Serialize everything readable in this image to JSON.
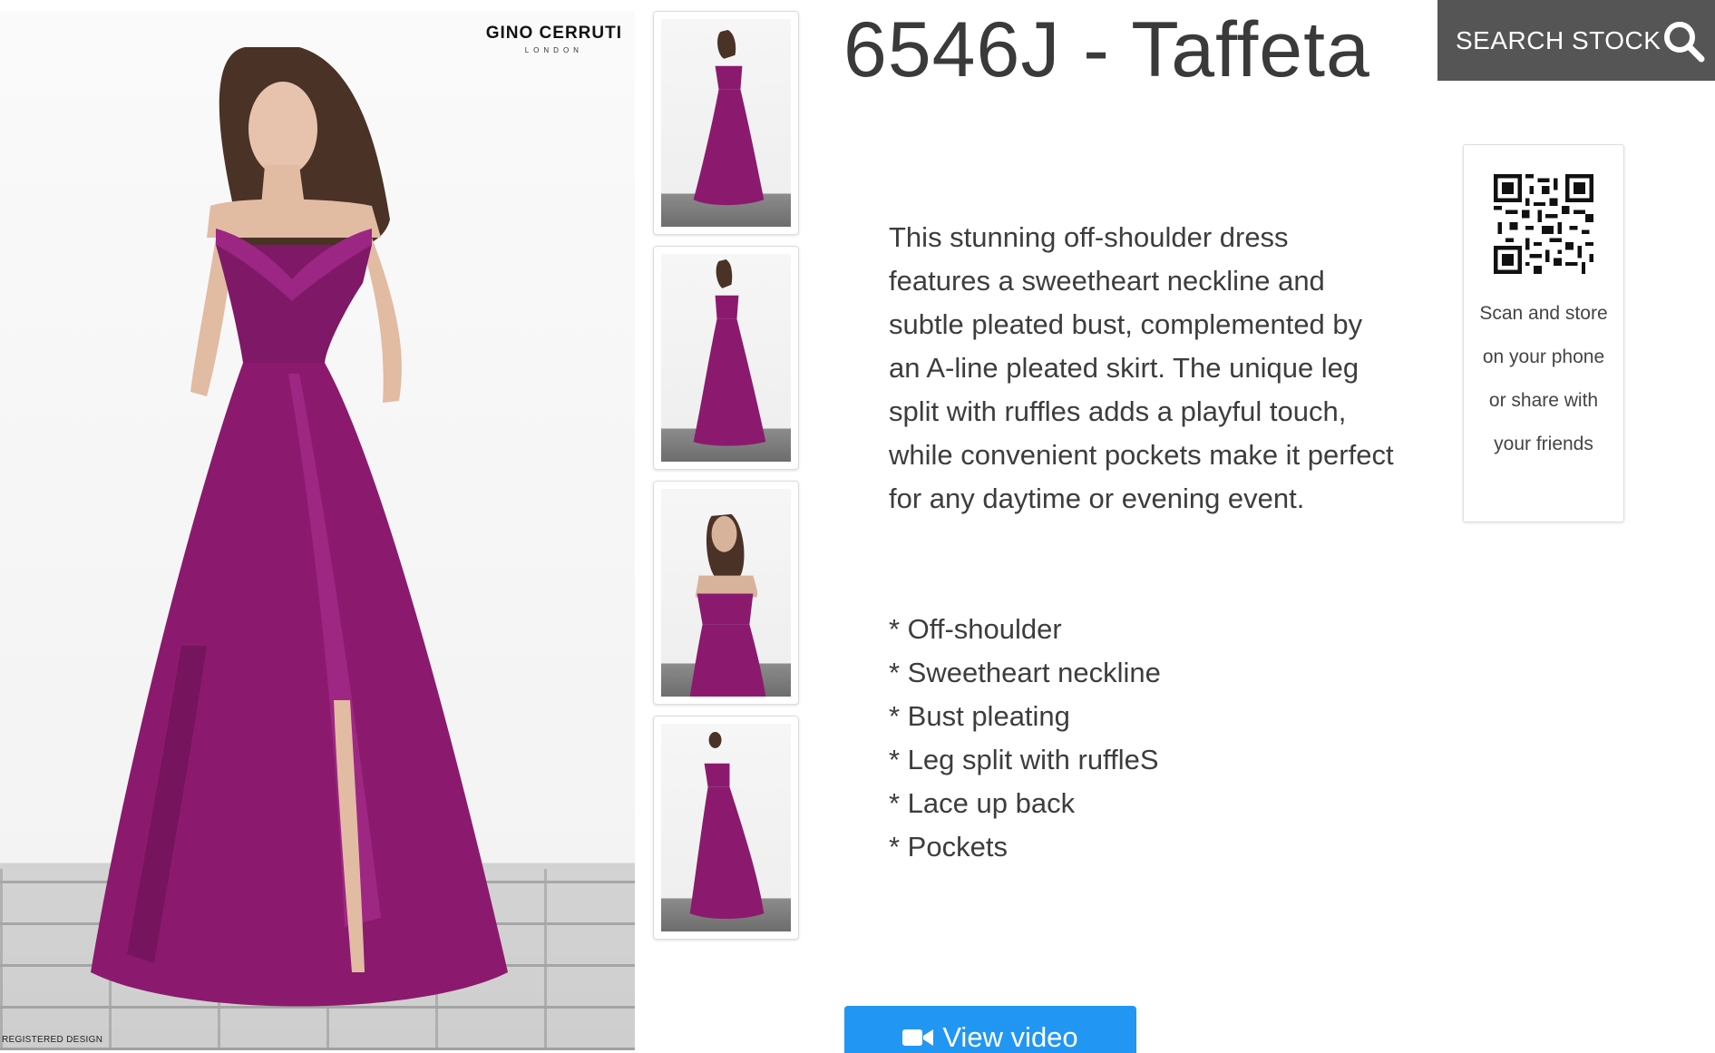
{
  "product": {
    "title": "6546J - Taffeta",
    "description": "This stunning off-shoulder dress features a sweetheart neckline and subtle pleated bust, complemented by an A-line pleated skirt. The unique leg split with ruffles adds a playful touch, while convenient pockets make it perfect for any daytime or evening event.",
    "features": [
      "* Off-shoulder",
      "* Sweetheart neckline",
      "* Bust pleating",
      "* Leg split with ruffleS",
      "* Lace up back",
      "* Pockets"
    ]
  },
  "main_image": {
    "brand_logo_line1": "GINO CERRUTI",
    "brand_logo_line2": "LONDON",
    "watermark": "REGISTERED DESIGN",
    "dress_color": "#8b1a6e"
  },
  "thumbnails": [
    {
      "icon": "thumbnail-front-full"
    },
    {
      "icon": "thumbnail-side-full"
    },
    {
      "icon": "thumbnail-front-half"
    },
    {
      "icon": "thumbnail-back-full"
    }
  ],
  "search": {
    "label": "SEARCH STOCK",
    "icon": "search-icon",
    "background": "#555555"
  },
  "qr": {
    "text": "Scan and store on your phone or share with your friends",
    "icon": "qr-code-icon"
  },
  "video": {
    "label": "View video",
    "icon": "video-camera-icon",
    "background": "#2196f3"
  }
}
